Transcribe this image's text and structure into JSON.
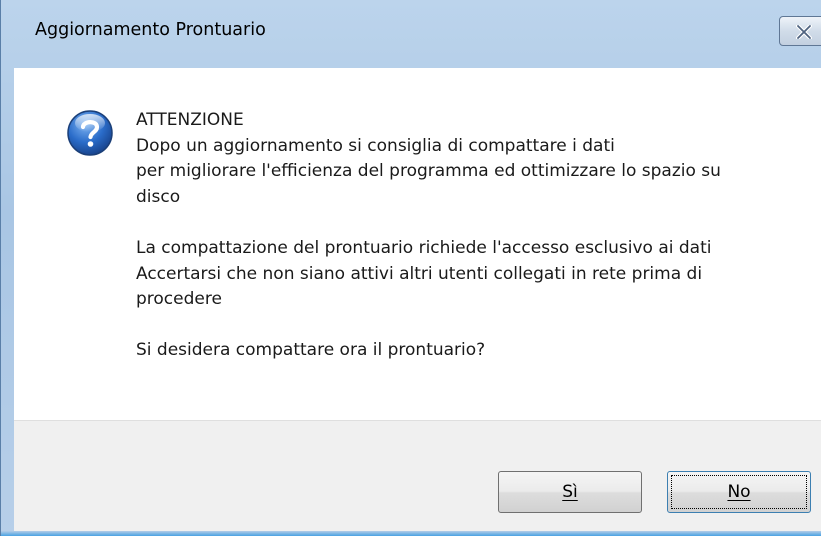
{
  "window": {
    "title": "Aggiornamento Prontuario",
    "close_icon": "close-icon"
  },
  "dialog": {
    "icon": "question-icon",
    "lines": [
      "ATTENZIONE",
      "Dopo un aggiornamento si consiglia di compattare i dati",
      "per migliorare l'efficienza del programma ed ottimizzare lo spazio su",
      "disco",
      "La compattazione del prontuario richiede l'accesso esclusivo ai dati",
      "Accertarsi che non siano attivi altri utenti collegati in rete prima di",
      "procedere",
      "Si desidera compattare ora il prontuario?"
    ]
  },
  "buttons": {
    "yes_label": "Sì",
    "no_label": "No"
  },
  "colors": {
    "frame": "#a9c6e4",
    "question_icon": "#2a6cc9"
  }
}
